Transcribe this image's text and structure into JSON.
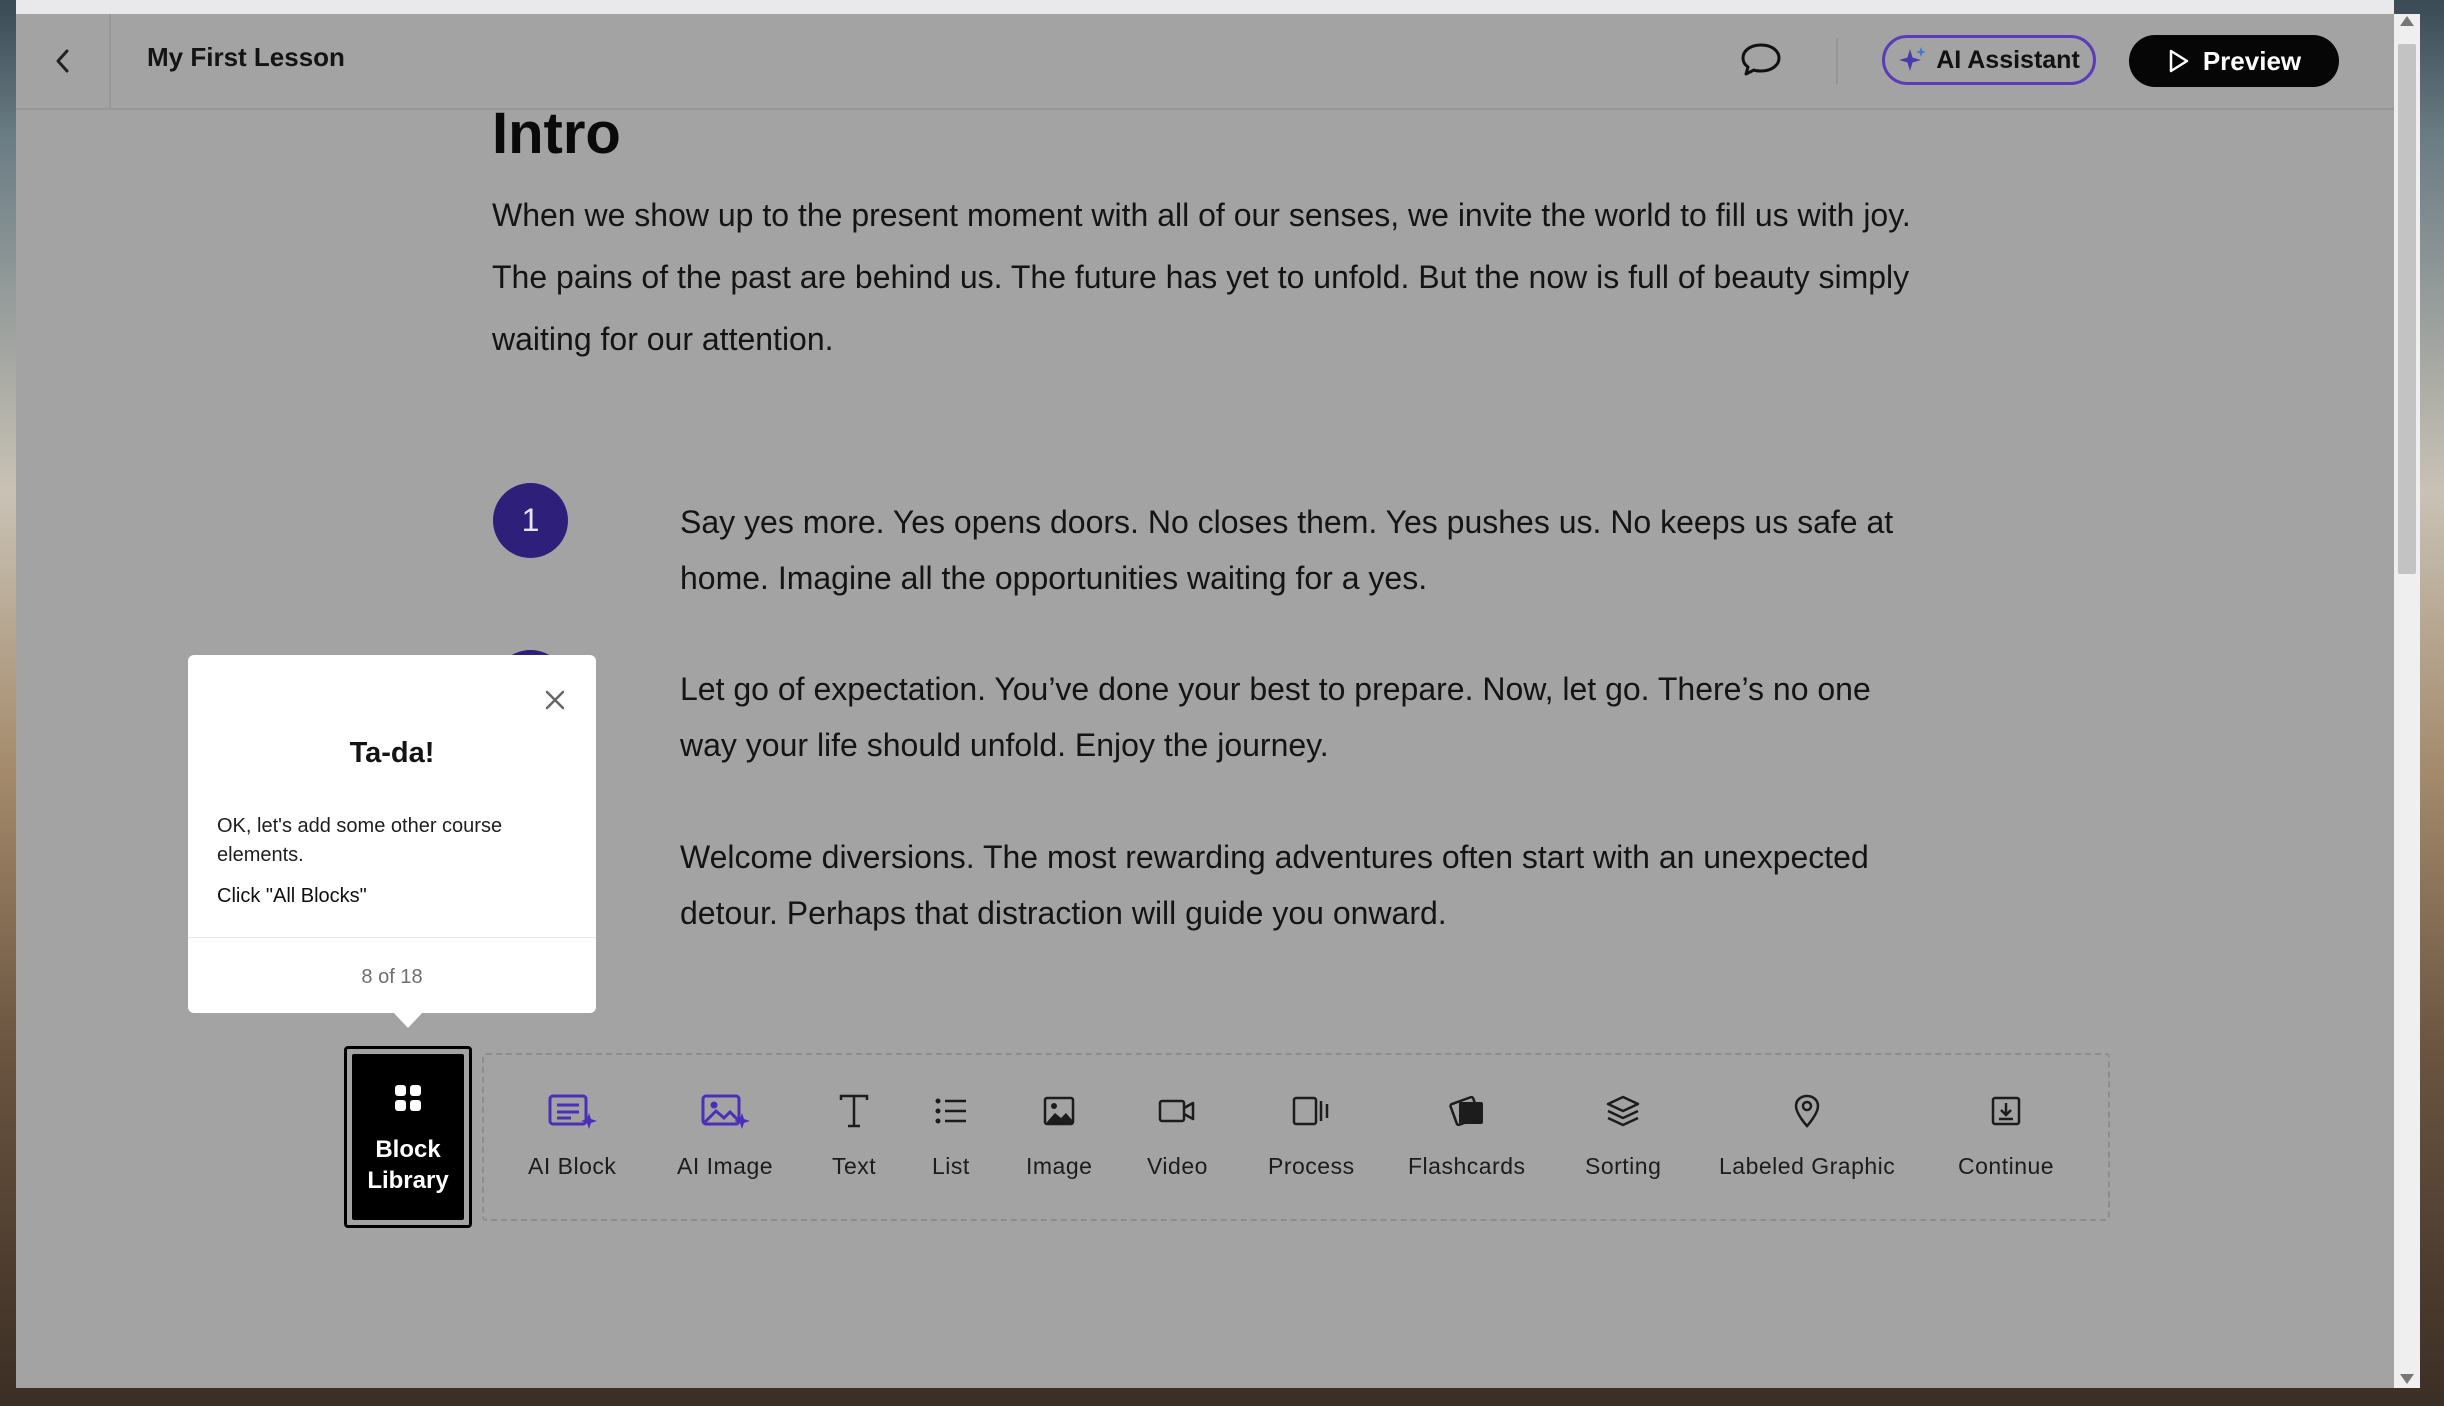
{
  "header": {
    "lesson_title": "My First Lesson",
    "ai_assistant_label": "AI Assistant",
    "preview_label": "Preview"
  },
  "content": {
    "intro_title": "Intro",
    "intro_text": "When we show up to the present moment with all of our senses, we invite the world to fill us with joy. The pains of the past are behind us. The future has yet to unfold. But the now is full of beauty simply waiting for our attention.",
    "steps": [
      {
        "number": "1",
        "text": "Say yes more. Yes opens doors. No closes them. Yes pushes us. No keeps us safe at home. Imagine all the opportunities waiting for a yes."
      },
      {
        "number": "",
        "text": "Let go of expectation. You’ve done your best to prepare. Now, let go. There’s no one way your life should unfold. Enjoy the journey."
      },
      {
        "number": "",
        "text": "Welcome diversions. The most rewarding adventures often start with an unexpected detour. Perhaps that distraction will guide you onward."
      }
    ]
  },
  "popover": {
    "title": "Ta-da!",
    "body": "OK, let's add some other course elements.",
    "cta": "Click \"All Blocks\"",
    "counter": "8 of 18"
  },
  "block_library": {
    "label_line1": "Block",
    "label_line2": "Library"
  },
  "toolbar": {
    "tools": [
      {
        "label": "AI Block",
        "icon": "ai-block-icon"
      },
      {
        "label": "AI Image",
        "icon": "ai-image-icon"
      },
      {
        "label": "Text",
        "icon": "text-icon"
      },
      {
        "label": "List",
        "icon": "list-icon"
      },
      {
        "label": "Image",
        "icon": "image-icon"
      },
      {
        "label": "Video",
        "icon": "video-icon"
      },
      {
        "label": "Process",
        "icon": "process-icon"
      },
      {
        "label": "Flashcards",
        "icon": "flashcards-icon"
      },
      {
        "label": "Sorting",
        "icon": "sorting-icon"
      },
      {
        "label": "Labeled Graphic",
        "icon": "labeled-graphic-icon"
      },
      {
        "label": "Continue",
        "icon": "continue-icon"
      }
    ]
  },
  "colors": {
    "accent_purple": "#5b3bb8",
    "step_circle": "#2d1f7a",
    "overlay_gray": "#a3a3a3"
  }
}
